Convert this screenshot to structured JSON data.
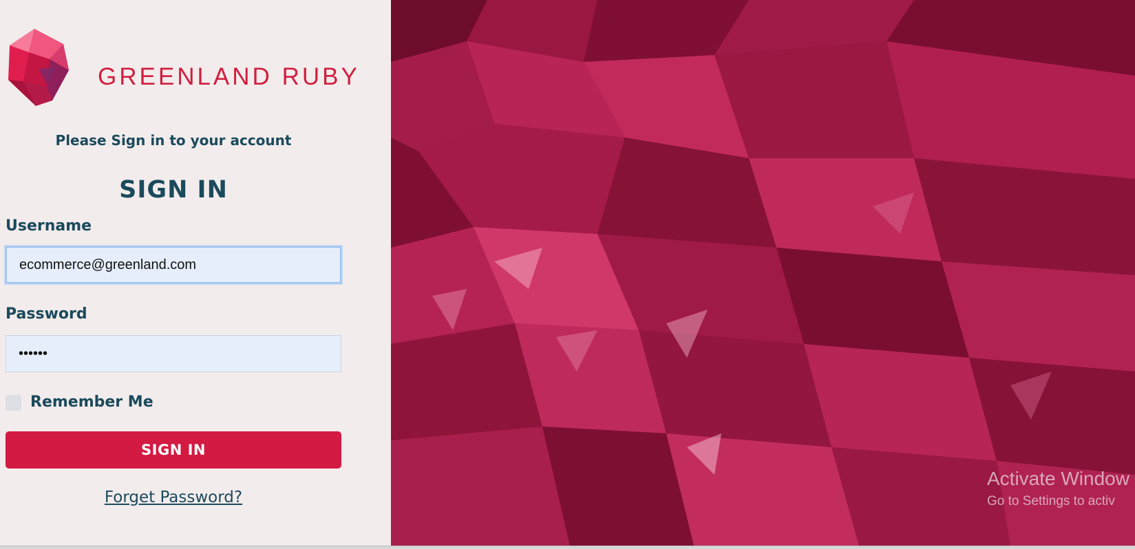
{
  "brand": {
    "logo_icon": "ruby-gem-icon",
    "name_first": "GREENLAND",
    "name_second": "RUBY",
    "color": "#cf1f3f"
  },
  "login": {
    "subtitle": "Please Sign in to your account",
    "heading": "SIGN IN",
    "username_label": "Username",
    "username_value": "ecommerce@greenland.com",
    "password_label": "Password",
    "password_value": "••••••",
    "remember_label": "Remember Me",
    "remember_checked": false,
    "submit_label": "SIGN IN",
    "forgot_label": "Forget Password?",
    "accent_color": "#d31a42",
    "text_color": "#1a4a5c"
  },
  "watermark": {
    "title": "Activate Window",
    "subtitle": "Go to Settings to activ"
  }
}
